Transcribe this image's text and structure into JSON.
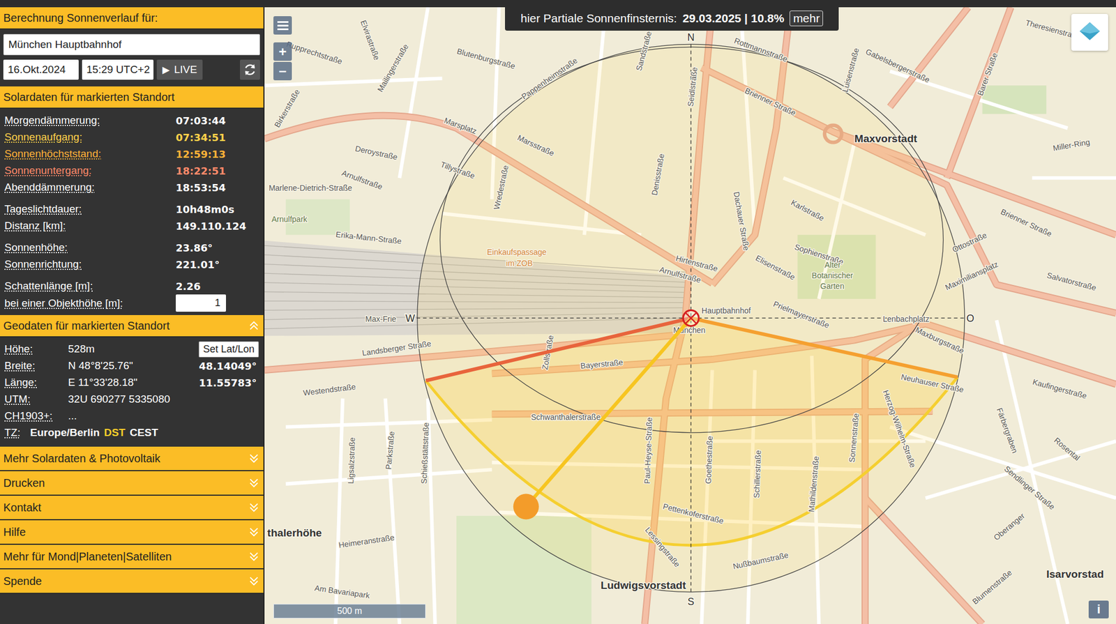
{
  "sidebar": {
    "title": "Berechnung Sonnenverlauf für:",
    "location": "München Hauptbahnhof",
    "date": "16.Okt.2024",
    "time": "15:29 UTC+2",
    "live_button": {
      "icon": "▶",
      "label": "LIVE"
    },
    "solar": {
      "title": "Solardaten für markierten Standort",
      "groups": [
        {
          "rows": [
            {
              "label": "Morgendämmerung:",
              "value": "07:03:44",
              "kind": "text",
              "color": "#ffffff"
            },
            {
              "label": "Sonnenaufgang:",
              "value": "07:34:51",
              "kind": "text",
              "color": "#ffd24a"
            },
            {
              "label": "Sonnenhöchststand:",
              "value": "12:59:13",
              "kind": "text",
              "color": "#ffb238"
            },
            {
              "label": "Sonnenuntergang:",
              "value": "18:22:51",
              "kind": "text",
              "color": "#ff8a6a"
            },
            {
              "label": "Abenddämmerung:",
              "value": "18:53:54",
              "kind": "text",
              "color": "#ffffff"
            }
          ]
        },
        {
          "rows": [
            {
              "label": "Tageslichtdauer:",
              "value": "10h48m0s",
              "kind": "text"
            },
            {
              "label": "Distanz [km]:",
              "value": "149.110.124",
              "kind": "text"
            }
          ]
        },
        {
          "rows": [
            {
              "label": "Sonnenhöhe:",
              "value": "23.86°",
              "kind": "text"
            },
            {
              "label": "Sonnenrichtung:",
              "value": "221.01°",
              "kind": "text"
            }
          ]
        },
        {
          "rows": [
            {
              "label": "Schattenlänge [m]:",
              "value": "2.26",
              "kind": "text"
            },
            {
              "label": "bei einer Objekthöhe [m]:",
              "value": "1",
              "kind": "input"
            }
          ]
        }
      ]
    },
    "geodata": {
      "title": "Geodaten für markierten Standort",
      "expanded": true,
      "rows": [
        {
          "label": "Höhe:",
          "value": "528m",
          "button": "Set Lat/Lon"
        },
        {
          "label": "Breite:",
          "value": "N 48°8'25.76\"",
          "decimal": "48.14049°"
        },
        {
          "label": "Länge:",
          "value": "E 11°33'28.18\"",
          "decimal": "11.55783°"
        },
        {
          "label": "UTM:",
          "value": "32U 690277 5335080"
        },
        {
          "label": "CH1903+:",
          "value": "..."
        }
      ],
      "timezone": {
        "label": "TZ:",
        "zone": "Europe/Berlin",
        "dst": "DST",
        "abbr": "CEST"
      }
    },
    "sections": [
      {
        "label": "Mehr Solardaten & Photovoltaik",
        "expanded": false
      },
      {
        "label": "Drucken",
        "expanded": false
      },
      {
        "label": "Kontakt",
        "expanded": false
      },
      {
        "label": "Hilfe",
        "expanded": false
      },
      {
        "label": "Mehr für Mond|Planeten|Satelliten",
        "expanded": false
      },
      {
        "label": "Spende",
        "expanded": false
      }
    ]
  },
  "map": {
    "banner": {
      "prefix": "hier Partiale Sonnenfinsternis:",
      "value": "29.03.2025 | 10.8%",
      "link": "mehr"
    },
    "zoom": {
      "in": "+",
      "out": "−"
    },
    "scale": "500 m",
    "info": "i",
    "compass": [
      {
        "label": "N"
      },
      {
        "label": "S"
      },
      {
        "label": "W"
      },
      {
        "label": "O"
      }
    ],
    "labels": [
      {
        "text": "Maxvorstadt",
        "kind": "district"
      },
      {
        "text": "Ludwigsvorstadt",
        "kind": "district"
      },
      {
        "text": "Isarvorstad",
        "kind": "district"
      },
      {
        "text": "thalerhöhe",
        "kind": "district"
      },
      {
        "text": "Arnulfpark",
        "kind": "area"
      },
      {
        "text": "Marsplatz",
        "kind": "street"
      },
      {
        "text": "Marsstraße",
        "kind": "street"
      },
      {
        "text": "Arnulfstraße",
        "kind": "street"
      },
      {
        "text": "Marlene-Dietrich-Straße",
        "kind": "street"
      },
      {
        "text": "Erika-Mann-Straße",
        "kind": "street"
      },
      {
        "text": "Deroystraße",
        "kind": "street"
      },
      {
        "text": "Tillystraße",
        "kind": "street"
      },
      {
        "text": "Wredestraße",
        "kind": "street"
      },
      {
        "text": "Pappenheimstraße",
        "kind": "street"
      },
      {
        "text": "Denisstraße",
        "kind": "street"
      },
      {
        "text": "Sandstraße",
        "kind": "street"
      },
      {
        "text": "Seidlstraße",
        "kind": "street"
      },
      {
        "text": "Dachauer Straße",
        "kind": "street"
      },
      {
        "text": "Karlstraße",
        "kind": "street"
      },
      {
        "text": "Hirtenstraße",
        "kind": "street"
      },
      {
        "text": "Arnulfstraße",
        "kind": "street"
      },
      {
        "text": "Elisenstraße",
        "kind": "street"
      },
      {
        "text": "Prielmayerstraße",
        "kind": "street"
      },
      {
        "text": "Sophienstraße",
        "kind": "street"
      },
      {
        "text": "Alter",
        "kind": "area"
      },
      {
        "text": "Botanischer",
        "kind": "area"
      },
      {
        "text": "Garten",
        "kind": "area"
      },
      {
        "text": "Einkaufspassage",
        "kind": "poi"
      },
      {
        "text": "im ZOB",
        "kind": "poi"
      },
      {
        "text": "Landsberger Straße",
        "kind": "street"
      },
      {
        "text": "Bayerstraße",
        "kind": "street"
      },
      {
        "text": "Westendstraße",
        "kind": "street"
      },
      {
        "text": "Zollstraße",
        "kind": "street"
      },
      {
        "text": "Schwanthalerstraße",
        "kind": "street"
      },
      {
        "text": "Paul-Heyse-Straße",
        "kind": "street"
      },
      {
        "text": "Goethestraße",
        "kind": "street"
      },
      {
        "text": "Schillerstraße",
        "kind": "street"
      },
      {
        "text": "Mathildenstraße",
        "kind": "street"
      },
      {
        "text": "Sonnenstraße",
        "kind": "street"
      },
      {
        "text": "Herzog-Wilhelm-Straße",
        "kind": "street"
      },
      {
        "text": "Pettenkoferstraße",
        "kind": "street"
      },
      {
        "text": "Nußbaumstraße",
        "kind": "street"
      },
      {
        "text": "Lessingstraße",
        "kind": "street"
      },
      {
        "text": "Schießstättstraße",
        "kind": "street"
      },
      {
        "text": "Parkstraße",
        "kind": "street"
      },
      {
        "text": "Ligsalzstraße",
        "kind": "street"
      },
      {
        "text": "Heimeranstraße",
        "kind": "street"
      },
      {
        "text": "Am Bavariapark",
        "kind": "street"
      },
      {
        "text": "Brienner Straße",
        "kind": "street"
      },
      {
        "text": "Rottmannstraße",
        "kind": "street"
      },
      {
        "text": "Gabelsbergerstraße",
        "kind": "street"
      },
      {
        "text": "Luisenstraße",
        "kind": "street"
      },
      {
        "text": "Barer Straße",
        "kind": "street"
      },
      {
        "text": "Theresienstraße",
        "kind": "street"
      },
      {
        "text": "Blutenburgstraße",
        "kind": "street"
      },
      {
        "text": "Elvirastraße",
        "kind": "street"
      },
      {
        "text": "Mailingerstraße",
        "kind": "street"
      },
      {
        "text": "Birkerstraße",
        "kind": "street"
      },
      {
        "text": "Rupprechtstraße",
        "kind": "street"
      },
      {
        "text": "Ottostraße",
        "kind": "street"
      },
      {
        "text": "Maximiliansplatz",
        "kind": "street"
      },
      {
        "text": "Salvatorstraße",
        "kind": "street"
      },
      {
        "text": "Lenbachplatz",
        "kind": "street"
      },
      {
        "text": "Maxburgstraße",
        "kind": "street"
      },
      {
        "text": "Neuhauser Straße",
        "kind": "street"
      },
      {
        "text": "Kaufingerstraße",
        "kind": "street"
      },
      {
        "text": "Färbergraben",
        "kind": "street"
      },
      {
        "text": "Rosental",
        "kind": "street"
      },
      {
        "text": "Sendlinger Straße",
        "kind": "street"
      },
      {
        "text": "Oberanger",
        "kind": "street"
      },
      {
        "text": "Blumenstraße",
        "kind": "street"
      },
      {
        "text": "Hauptbahnhof",
        "kind": "street"
      },
      {
        "text": "München",
        "kind": "street"
      },
      {
        "text": "Brienner Straße",
        "kind": "street"
      },
      {
        "text": "Miller-Ring",
        "kind": "street"
      },
      {
        "text": "Max-Frie",
        "kind": "street"
      }
    ]
  }
}
